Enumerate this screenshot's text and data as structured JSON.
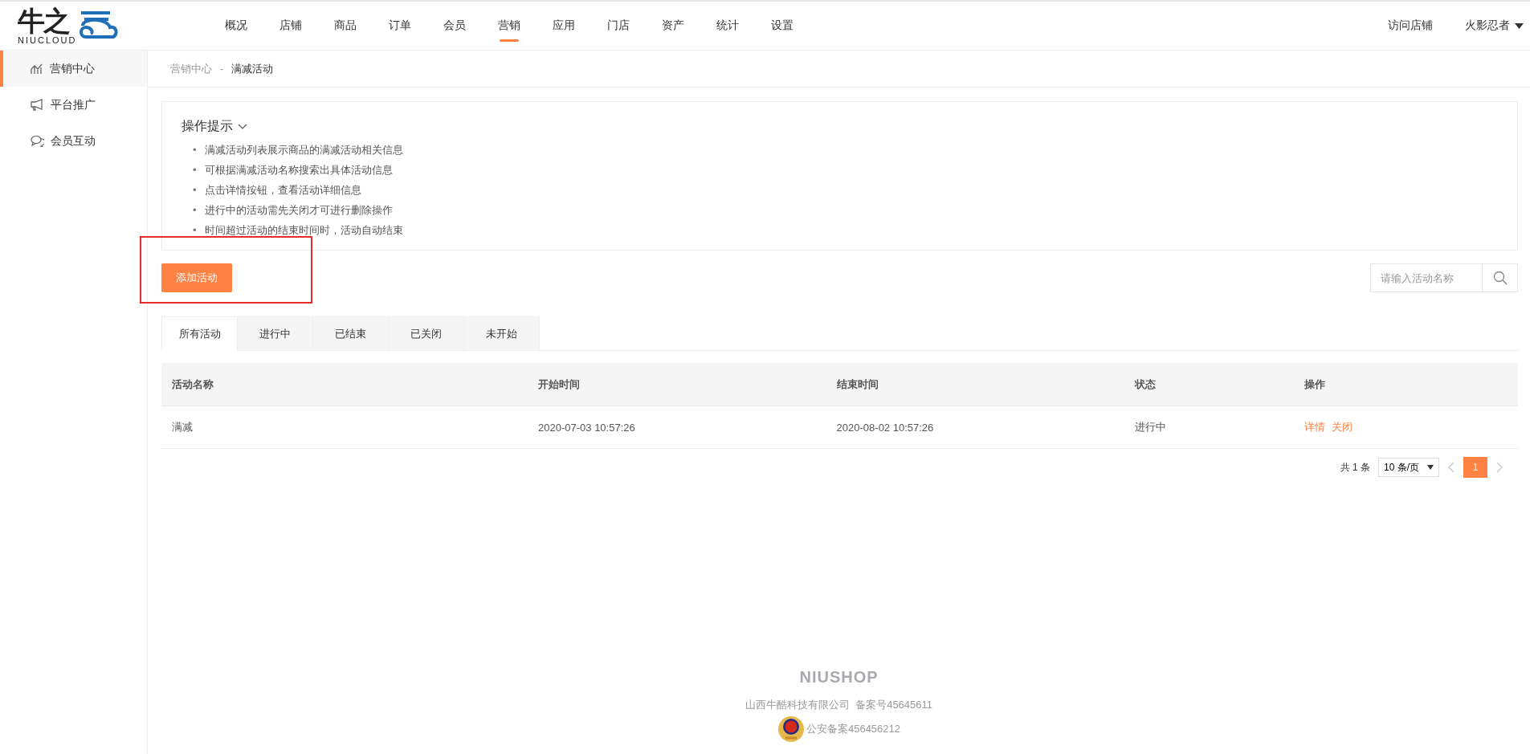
{
  "logo": {
    "mark": "牛之",
    "name": "NIUCLOUD"
  },
  "nav": [
    {
      "label": "概况",
      "selected": false
    },
    {
      "label": "店铺",
      "selected": false
    },
    {
      "label": "商品",
      "selected": false
    },
    {
      "label": "订单",
      "selected": false
    },
    {
      "label": "会员",
      "selected": false
    },
    {
      "label": "营销",
      "selected": true
    },
    {
      "label": "应用",
      "selected": false
    },
    {
      "label": "门店",
      "selected": false
    },
    {
      "label": "资产",
      "selected": false
    },
    {
      "label": "统计",
      "selected": false
    },
    {
      "label": "设置",
      "selected": false
    }
  ],
  "header_right": {
    "visit_store": "访问店铺",
    "user": "火影忍者"
  },
  "sidebar": {
    "items": [
      {
        "label": "营销中心",
        "kind": "chart",
        "selected": true
      },
      {
        "label": "平台推广",
        "kind": "megaphone",
        "selected": false
      },
      {
        "label": "会员互动",
        "kind": "chat",
        "selected": false
      }
    ]
  },
  "breadcrumb": [
    "营销中心",
    "-",
    "满减活动"
  ],
  "tips": {
    "title": "操作提示",
    "expanded": true,
    "bullet": "•",
    "items": [
      "满减活动列表展示商品的满减活动相关信息",
      "可根据满减活动名称搜索出具体活动信息",
      "点击详情按钮，查看活动详细信息",
      "进行中的活动需先关闭才可进行删除操作",
      "时间超过活动的结束时间时，活动自动结束"
    ]
  },
  "add_button": "添加活动",
  "search": {
    "placeholder": "请输入活动名称"
  },
  "tabs": [
    {
      "label": "所有活动",
      "selected": true
    },
    {
      "label": "进行中",
      "selected": false
    },
    {
      "label": "已结束",
      "selected": false
    },
    {
      "label": "已关闭",
      "selected": false
    },
    {
      "label": "未开始",
      "selected": false
    }
  ],
  "table": {
    "columns": [
      "活动名称",
      "开始时间",
      "结束时间",
      "状态",
      "操作"
    ],
    "rows": [
      {
        "name": "满减",
        "start": "2020-07-03 10:57:26",
        "end": "2020-08-02 10:57:26",
        "status": "进行中",
        "actions": [
          "详情",
          "关闭"
        ]
      }
    ]
  },
  "pagination": {
    "total": "共 1 条",
    "page_size": "10 条/页",
    "pages": [
      {
        "label": "1",
        "selected": true
      }
    ]
  },
  "footer": {
    "brand": "NIUSHOP",
    "company": "山西牛酷科技有限公司  备案号45645611",
    "police": "公安备案456456212"
  }
}
